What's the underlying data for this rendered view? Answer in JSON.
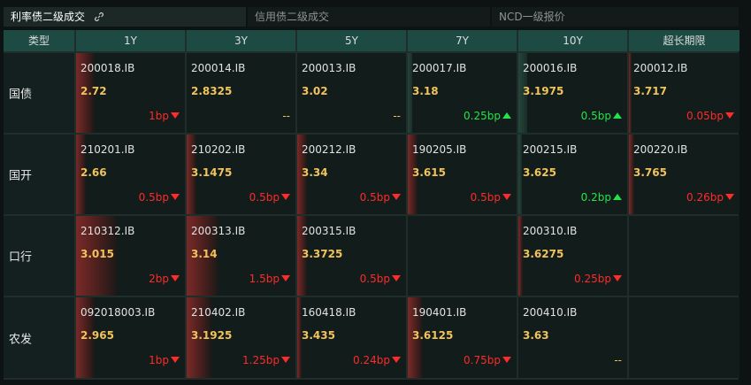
{
  "tabs": [
    {
      "label": "利率债二级成交",
      "active": true
    },
    {
      "label": "信用债二级成交",
      "active": false
    },
    {
      "label": "NCD一级报价",
      "active": false
    }
  ],
  "headers": [
    "类型",
    "1Y",
    "3Y",
    "5Y",
    "7Y",
    "10Y",
    "超长期限"
  ],
  "rows": [
    {
      "type": "国债",
      "cells": [
        {
          "code": "200018.IB",
          "yield": "2.72",
          "change": "1bp",
          "direction": "down",
          "level": 0.17
        },
        {
          "code": "200014.IB",
          "yield": "2.8325",
          "change": "--",
          "direction": "flat",
          "level": 0
        },
        {
          "code": "200013.IB",
          "yield": "3.02",
          "change": "--",
          "direction": "flat",
          "level": 0
        },
        {
          "code": "200017.IB",
          "yield": "3.18",
          "change": "0.25bp",
          "direction": "up",
          "level": 0.04
        },
        {
          "code": "200016.IB",
          "yield": "3.1975",
          "change": "0.5bp",
          "direction": "up",
          "level": 0.08
        },
        {
          "code": "200012.IB",
          "yield": "3.717",
          "change": "0.05bp",
          "direction": "down",
          "level": 0.02
        }
      ]
    },
    {
      "type": "国开",
      "cells": [
        {
          "code": "210201.IB",
          "yield": "2.66",
          "change": "0.5bp",
          "direction": "down",
          "level": 0.09
        },
        {
          "code": "210202.IB",
          "yield": "3.1475",
          "change": "0.5bp",
          "direction": "down",
          "level": 0.09
        },
        {
          "code": "200212.IB",
          "yield": "3.34",
          "change": "0.5bp",
          "direction": "down",
          "level": 0.09
        },
        {
          "code": "190205.IB",
          "yield": "3.615",
          "change": "0.5bp",
          "direction": "down",
          "level": 0.09
        },
        {
          "code": "200215.IB",
          "yield": "3.625",
          "change": "0.2bp",
          "direction": "up",
          "level": 0.03
        },
        {
          "code": "200220.IB",
          "yield": "3.765",
          "change": "0.26bp",
          "direction": "down",
          "level": 0.05
        }
      ]
    },
    {
      "type": "口行",
      "cells": [
        {
          "code": "210312.IB",
          "yield": "3.015",
          "change": "2bp",
          "direction": "down",
          "level": 0.37
        },
        {
          "code": "200313.IB",
          "yield": "3.14",
          "change": "1.5bp",
          "direction": "down",
          "level": 0.29
        },
        {
          "code": "200315.IB",
          "yield": "3.3725",
          "change": "0.5bp",
          "direction": "down",
          "level": 0.09
        },
        {
          "code": "",
          "yield": "",
          "change": "",
          "direction": "none",
          "level": 0
        },
        {
          "code": "200310.IB",
          "yield": "3.6275",
          "change": "0.25bp",
          "direction": "down",
          "level": 0.04
        },
        {
          "code": "",
          "yield": "",
          "change": "",
          "direction": "none",
          "level": 0
        }
      ]
    },
    {
      "type": "农发",
      "cells": [
        {
          "code": "092018003.IB",
          "yield": "2.965",
          "change": "1bp",
          "direction": "down",
          "level": 0.17
        },
        {
          "code": "210402.IB",
          "yield": "3.1925",
          "change": "1.25bp",
          "direction": "down",
          "level": 0.23
        },
        {
          "code": "160418.IB",
          "yield": "3.435",
          "change": "0.24bp",
          "direction": "down",
          "level": 0.04
        },
        {
          "code": "190401.IB",
          "yield": "3.6125",
          "change": "0.75bp",
          "direction": "down",
          "level": 0.14
        },
        {
          "code": "200410.IB",
          "yield": "3.63",
          "change": "--",
          "direction": "flat",
          "level": 0
        },
        {
          "code": "",
          "yield": "",
          "change": "",
          "direction": "none",
          "level": 0
        }
      ]
    }
  ],
  "colors": {
    "down": "#ff2a2a",
    "up": "#22e34a",
    "yield": "#f2c35a",
    "header_bg": "#1e4a44"
  },
  "icons": {
    "tab_link": "link-icon",
    "down": "triangle-down-icon",
    "up": "triangle-up-icon"
  }
}
